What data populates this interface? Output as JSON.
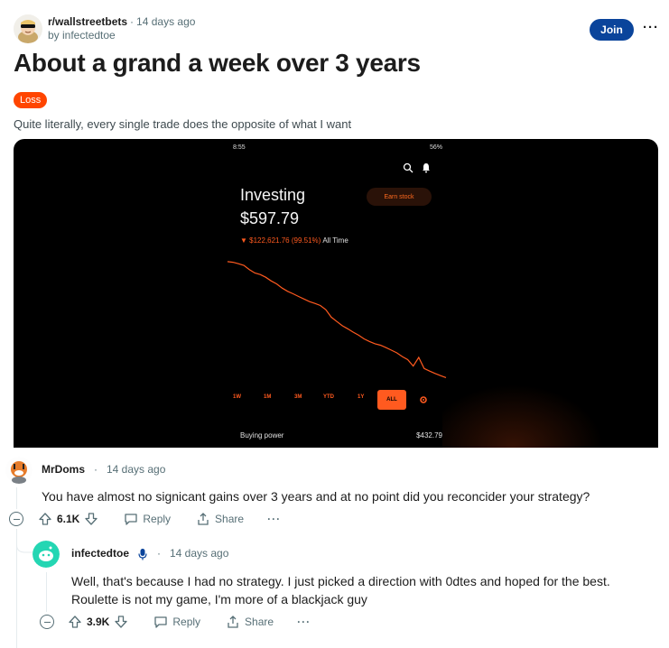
{
  "post": {
    "subreddit": "r/wallstreetbets",
    "time": "14 days ago",
    "author": "by infectedtoe",
    "join_label": "Join",
    "more_label": "···",
    "title": "About a grand a week over 3 years",
    "flair": "Loss",
    "body": "Quite literally, every single trade does the opposite of what I want"
  },
  "screenshot": {
    "status_time": "8:55",
    "status_right": "56%",
    "investing_label": "Investing",
    "investing_value": "$597.79",
    "change": "▼ $122,621.76 (99.51%)",
    "change_period": "All Time",
    "earn_label": "Earn stock",
    "ranges": [
      "1W",
      "1M",
      "3M",
      "YTD",
      "1Y",
      "ALL"
    ],
    "active_range": "ALL",
    "buying_power_label": "Buying power",
    "buying_power_value": "$432.79"
  },
  "chart_data": {
    "type": "line",
    "title": "",
    "xlabel": "",
    "ylabel": "",
    "x": [
      0,
      1,
      2,
      3,
      4,
      5,
      6,
      7,
      8,
      9,
      10,
      11,
      12,
      13,
      14,
      15,
      16,
      17,
      18,
      19,
      20,
      21,
      22,
      23,
      24,
      25,
      26,
      27,
      28,
      29,
      30,
      31,
      32,
      33,
      34,
      35,
      36,
      37,
      38,
      39,
      40
    ],
    "series": [
      {
        "values": [
          123200,
          122500,
          121000,
          119300,
          114800,
          111200,
          109500,
          106700,
          102800,
          99600,
          95200,
          91800,
          89200,
          86400,
          83700,
          80900,
          79000,
          76800,
          72300,
          64500,
          59900,
          55400,
          52200,
          48700,
          45400,
          41500,
          38700,
          36400,
          34800,
          32300,
          29600,
          26700,
          22800,
          19600,
          12800,
          21900,
          10200,
          7400,
          5000,
          2700,
          600
        ]
      }
    ],
    "ylim": [
      0,
      125000
    ],
    "color": "#ff5a1f"
  },
  "comments": [
    {
      "author": "MrDoms",
      "dot": "·",
      "time": "14 days ago",
      "text": "You have almost no signicant gains over 3 years and at no point did you reconcider your strategy?",
      "votes": "6.1K",
      "reply_label": "Reply",
      "share_label": "Share",
      "more_label": "···"
    },
    {
      "author": "infectedtoe",
      "dot": "·",
      "time": "14 days ago",
      "text_line1": "Well, that's because I had no strategy. I just picked a direction with 0dtes and hoped for the best.",
      "text_line2": "Roulette is not my game, I'm more of a blackjack guy",
      "votes": "3.9K",
      "reply_label": "Reply",
      "share_label": "Share",
      "more_label": "···"
    }
  ],
  "colors": {
    "accent_orange": "#ff4500",
    "join_blue": "#0a449b",
    "chart_orange": "#ff5a1f"
  }
}
